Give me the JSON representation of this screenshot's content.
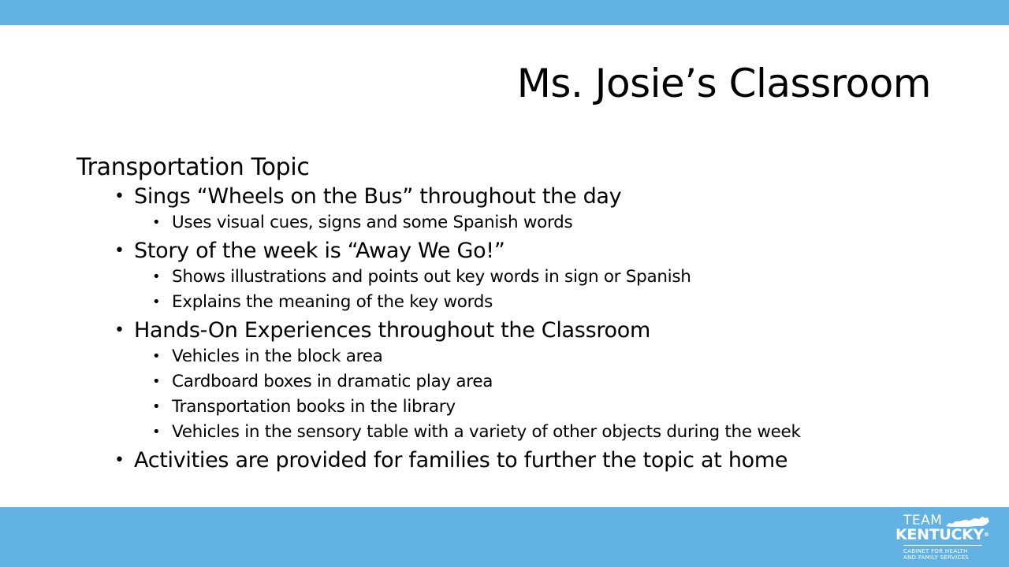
{
  "colors": {
    "bar": "#62b3e4",
    "text": "#000000",
    "logo_text": "#ffffff"
  },
  "slide": {
    "title": "Ms. Josie’s Classroom",
    "topic": "Transportation Topic",
    "bullets": [
      {
        "text": "Sings “Wheels on the Bus” throughout the day",
        "subs": [
          "Uses visual cues, signs and some Spanish words"
        ]
      },
      {
        "text": "Story of the week is “Away We Go!”",
        "subs": [
          "Shows illustrations and points out key words in sign or Spanish",
          "Explains the meaning of the key words"
        ]
      },
      {
        "text": "Hands-On Experiences throughout the Classroom",
        "subs": [
          "Vehicles in the block area",
          "Cardboard boxes in dramatic play area",
          "Transportation books in the library",
          "Vehicles in the sensory table with a variety of other objects during the week"
        ]
      },
      {
        "text": "Activities are provided for families to further the topic at home",
        "subs": []
      }
    ],
    "bullet_glyph": "•"
  },
  "logo": {
    "team": "TEAM",
    "kentucky": "KENTUCKY",
    "registered": "®",
    "line1": "CABINET FOR HEALTH",
    "line2": "AND FAMILY SERVICES",
    "shape_icon": "kentucky-state-outline-icon"
  }
}
